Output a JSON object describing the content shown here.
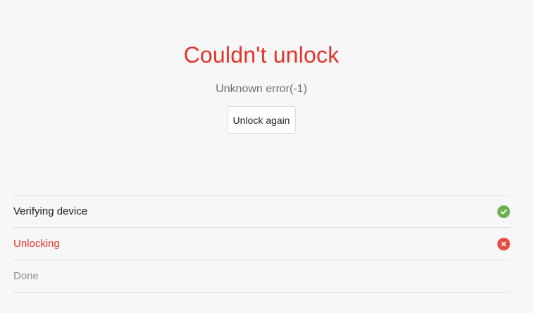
{
  "dialog": {
    "title": "Couldn't unlock",
    "error_message": "Unknown error(-1)",
    "retry_label": "Unlock again"
  },
  "steps": [
    {
      "label": "Verifying device",
      "status": "success",
      "icon": "check-circle-icon",
      "color": "#6ab04c"
    },
    {
      "label": "Unlocking",
      "status": "error",
      "icon": "x-circle-icon",
      "color": "#e2352b"
    },
    {
      "label": "Done",
      "status": "pending",
      "icon": "",
      "color": "#8c8c8c"
    }
  ],
  "colors": {
    "accent_error": "#e2352b",
    "success": "#6ab04c",
    "background": "#f7f7f7"
  }
}
